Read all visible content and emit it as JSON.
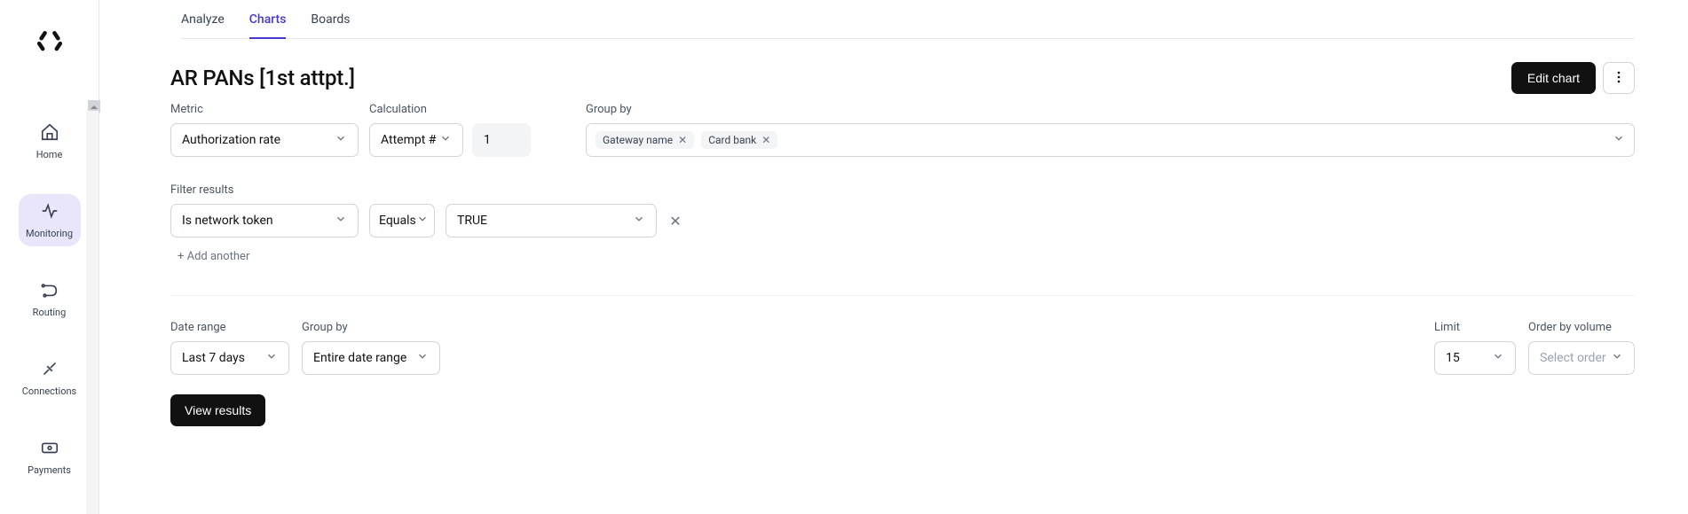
{
  "sidebar": {
    "items": [
      {
        "label": "Home"
      },
      {
        "label": "Monitoring"
      },
      {
        "label": "Routing"
      },
      {
        "label": "Connections"
      },
      {
        "label": "Payments"
      }
    ]
  },
  "tabs": {
    "analyze": "Analyze",
    "charts": "Charts",
    "boards": "Boards"
  },
  "chart": {
    "title": "AR PANs [1st attpt.]",
    "edit_label": "Edit chart"
  },
  "metric": {
    "label": "Metric",
    "value": "Authorization rate"
  },
  "calculation": {
    "label": "Calculation",
    "value": "Attempt #",
    "number": "1"
  },
  "group_by": {
    "label": "Group by",
    "tags": [
      "Gateway name",
      "Card bank"
    ]
  },
  "filter": {
    "label": "Filter results",
    "field": "Is network token",
    "op": "Equals",
    "value": "TRUE",
    "add": "+ Add another"
  },
  "date_range": {
    "label": "Date range",
    "value": "Last 7 days"
  },
  "group_by2": {
    "label": "Group by",
    "value": "Entire date range"
  },
  "limit": {
    "label": "Limit",
    "value": "15"
  },
  "order": {
    "label": "Order by volume",
    "placeholder": "Select order"
  },
  "actions": {
    "view_results": "View results"
  }
}
